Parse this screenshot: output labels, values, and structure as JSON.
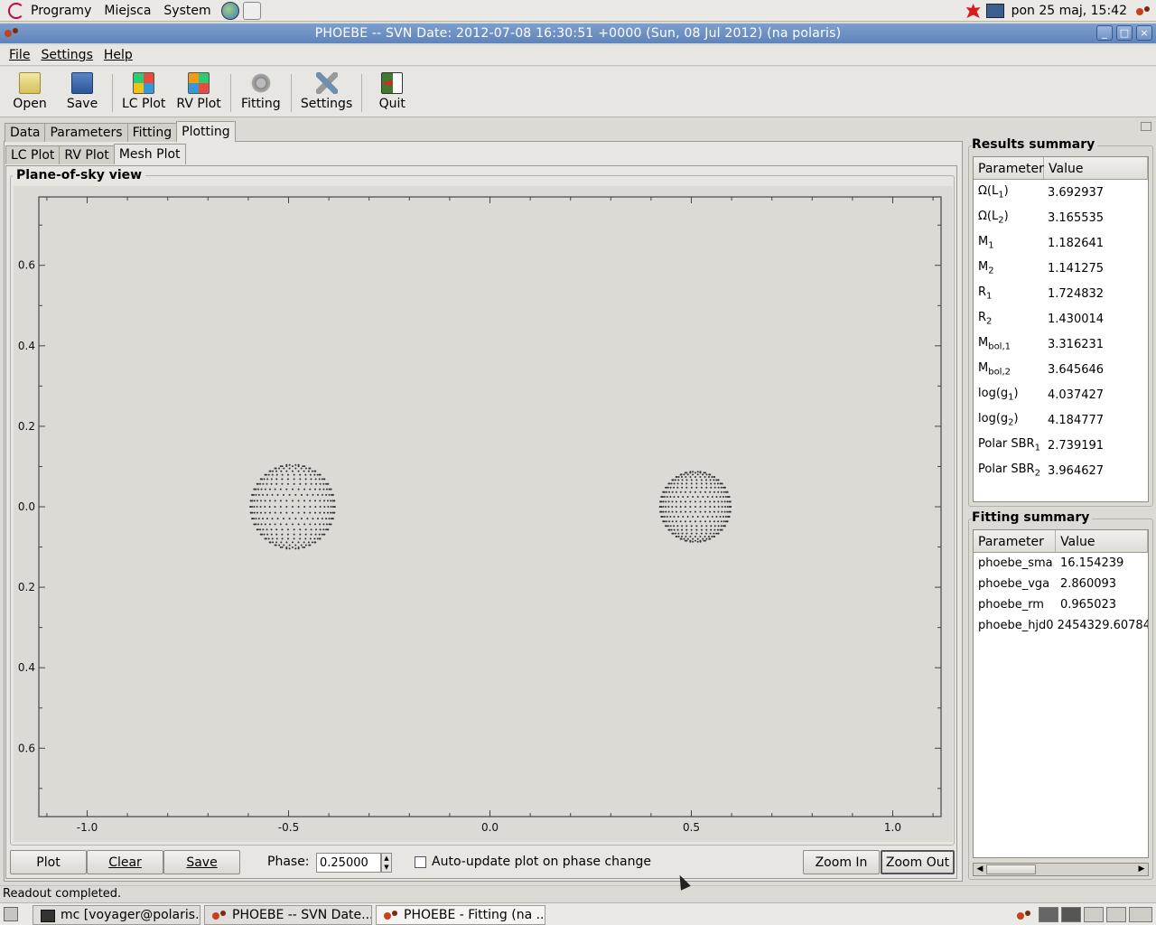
{
  "top_panel": {
    "menus": [
      "Programy",
      "Miejsca",
      "System"
    ],
    "clock": "pon 25 maj, 15:42"
  },
  "window": {
    "title": "PHOEBE -- SVN Date: 2012-07-08 16:30:51 +0000 (Sun, 08 Jul 2012)  (na polaris)"
  },
  "menubar": {
    "file": "File",
    "settings": "Settings",
    "help": "Help"
  },
  "toolbar": {
    "open": "Open",
    "save": "Save",
    "lc_plot": "LC Plot",
    "rv_plot": "RV Plot",
    "fitting": "Fitting",
    "settings": "Settings",
    "quit": "Quit"
  },
  "tabs": {
    "data": "Data",
    "parameters": "Parameters",
    "fitting": "Fitting",
    "plotting": "Plotting"
  },
  "subtabs": {
    "lc": "LC Plot",
    "rv": "RV Plot",
    "mesh": "Mesh Plot"
  },
  "plot": {
    "group_title": "Plane-of-sky view",
    "x_ticks": [
      "-1.0",
      "-0.5",
      "0.0",
      "0.5",
      "1.0"
    ],
    "y_ticks": [
      "0.6",
      "0.4",
      "0.2",
      "0.0",
      "0.2",
      "0.4",
      "0.6"
    ]
  },
  "chart_data": {
    "type": "scatter",
    "title": "Plane-of-sky view",
    "xlim": [
      -1.12,
      1.12
    ],
    "ylim": [
      -0.77,
      0.77
    ],
    "x_tick_values": [
      -1.0,
      -0.5,
      0.0,
      0.5,
      1.0
    ],
    "y_tick_values": [
      0.6,
      0.4,
      0.2,
      0.0,
      -0.2,
      -0.4,
      -0.6
    ],
    "stars": [
      {
        "center_x": -0.49,
        "center_y": 0.0,
        "radius": 0.105
      },
      {
        "center_x": 0.51,
        "center_y": 0.0,
        "radius": 0.088
      }
    ],
    "point_color": "#333333",
    "background": "#dcdad5"
  },
  "controls": {
    "plot": "Plot",
    "clear": "Clear",
    "save": "Save",
    "phase_label": "Phase:",
    "phase_value": "0.25000",
    "auto_update": "Auto-update plot on phase change",
    "zoom_in": "Zoom In",
    "zoom_out": "Zoom Out"
  },
  "results_summary": {
    "title": "Results summary",
    "col_param": "Parameter",
    "col_value": "Value",
    "rows": [
      {
        "base": "Ω(L",
        "sub": "1",
        "tail": ")",
        "value": "3.692937"
      },
      {
        "base": "Ω(L",
        "sub": "2",
        "tail": ")",
        "value": "3.165535"
      },
      {
        "base": "M",
        "sub": "1",
        "tail": "",
        "value": "1.182641"
      },
      {
        "base": "M",
        "sub": "2",
        "tail": "",
        "value": "1.141275"
      },
      {
        "base": "R",
        "sub": "1",
        "tail": "",
        "value": "1.724832"
      },
      {
        "base": "R",
        "sub": "2",
        "tail": "",
        "value": "1.430014"
      },
      {
        "base": "M",
        "sub": "bol,1",
        "tail": "",
        "value": "3.316231"
      },
      {
        "base": "M",
        "sub": "bol,2",
        "tail": "",
        "value": "3.645646"
      },
      {
        "base": "log(g",
        "sub": "1",
        "tail": ")",
        "value": "4.037427"
      },
      {
        "base": "log(g",
        "sub": "2",
        "tail": ")",
        "value": "4.184777"
      },
      {
        "base": "Polar SBR",
        "sub": "1",
        "tail": "",
        "value": "2.739191"
      },
      {
        "base": "Polar SBR",
        "sub": "2",
        "tail": "",
        "value": "3.964627"
      }
    ]
  },
  "fitting_summary": {
    "title": "Fitting summary",
    "col_param": "Parameter",
    "col_value": "Value",
    "rows": [
      {
        "param": "phoebe_sma",
        "value": "16.154239"
      },
      {
        "param": "phoebe_vga",
        "value": "2.860093"
      },
      {
        "param": "phoebe_rm",
        "value": "0.965023"
      },
      {
        "param": "phoebe_hjd0",
        "value": "2454329.60784"
      }
    ]
  },
  "status": "Readout completed.",
  "taskbar": {
    "tasks": [
      "mc [voyager@polaris...",
      "PHOEBE -- SVN Date...",
      "PHOEBE - Fitting (na ..."
    ]
  }
}
